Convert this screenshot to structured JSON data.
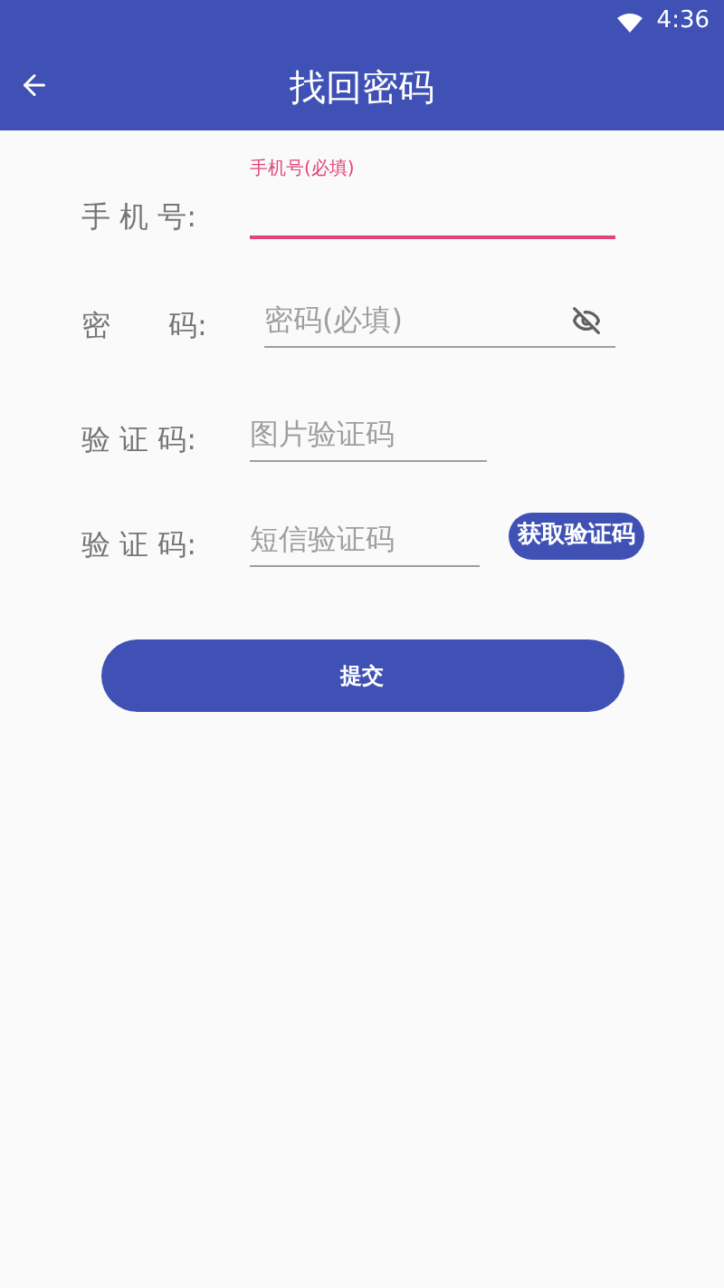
{
  "status_bar": {
    "time": "4:36"
  },
  "app_bar": {
    "title": "找回密码"
  },
  "fields": [
    {
      "kind": "floating",
      "label": "手 机 号:",
      "placeholder": "手机号(必填)",
      "focused": true
    },
    {
      "kind": "password",
      "label": "密　　码:",
      "placeholder": "密码(必填)",
      "focused": false
    },
    {
      "kind": "plain",
      "label": "验 证 码:",
      "placeholder": "图片验证码",
      "focused": false
    },
    {
      "kind": "sms",
      "label": "验 证 码:",
      "placeholder": "短信验证码",
      "focused": false,
      "button": "获取验证码"
    }
  ],
  "submit": "提交"
}
